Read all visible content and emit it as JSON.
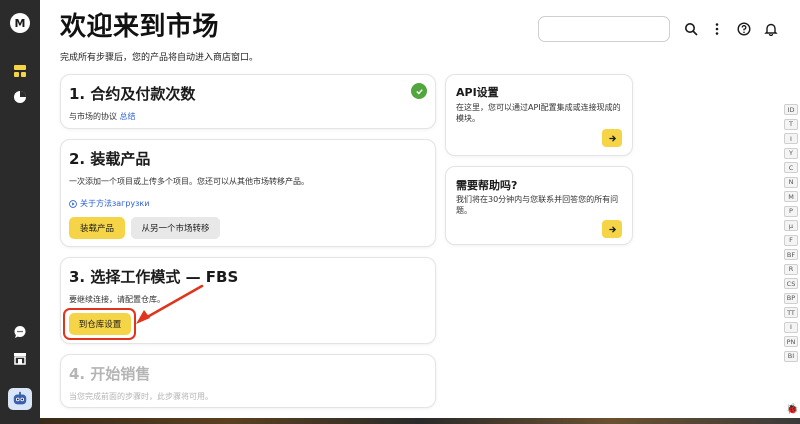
{
  "header": {
    "title": "欢迎来到市场",
    "subtitle": "完成所有步骤后，您的产品将自动进入商店窗口。"
  },
  "sidebar": {
    "logo_icon": "market-logo",
    "items": [
      {
        "icon": "dashboard-icon"
      },
      {
        "icon": "pie-chart-icon"
      },
      {
        "icon": "chat-icon"
      },
      {
        "icon": "store-icon"
      }
    ],
    "avatar_icon": "robot-avatar"
  },
  "topbar": {
    "search_placeholder": "",
    "icons": [
      "search-icon",
      "more-icon",
      "help-icon",
      "bell-icon"
    ]
  },
  "steps": [
    {
      "title": "1. 合约及付款次数",
      "text": "与市场的协议",
      "link": "总结",
      "completed": true
    },
    {
      "title": "2. 装载产品",
      "text": "一次添加一个项目或上传多个项目。您还可以从其他市场转移产品。",
      "link": "关于方法загрузки",
      "buttons": [
        "装载产品",
        "从另一个市场转移"
      ]
    },
    {
      "title": "3. 选择工作模式 — FBS",
      "text": "要继续连接，请配置仓库。",
      "buttons": [
        "到仓库设置"
      ]
    },
    {
      "title": "4. 开始销售",
      "text": "当您完成前面的步骤时，此步骤将可用。",
      "disabled": true
    }
  ],
  "side_cards": [
    {
      "title": "API设置",
      "text": "在这里，您可以通过API配置集成或连接现成的模块。"
    },
    {
      "title": "需要帮助吗?",
      "text": "我们将在30分钟内与您联系并回答您的所有问题。"
    }
  ],
  "alphabet": [
    "ID",
    "T",
    "I",
    "Y",
    "C",
    "N",
    "M",
    "P",
    "µ",
    "F",
    "BF",
    "R",
    "CS",
    "BP",
    "TT",
    "I",
    "PN",
    "BI"
  ],
  "colors": {
    "accent_yellow": "#f5d547",
    "sidebar_bg": "#2b2b2b",
    "success_green": "#53a63f",
    "annotation_red": "#e0341c",
    "link_blue": "#2b5fd9"
  }
}
